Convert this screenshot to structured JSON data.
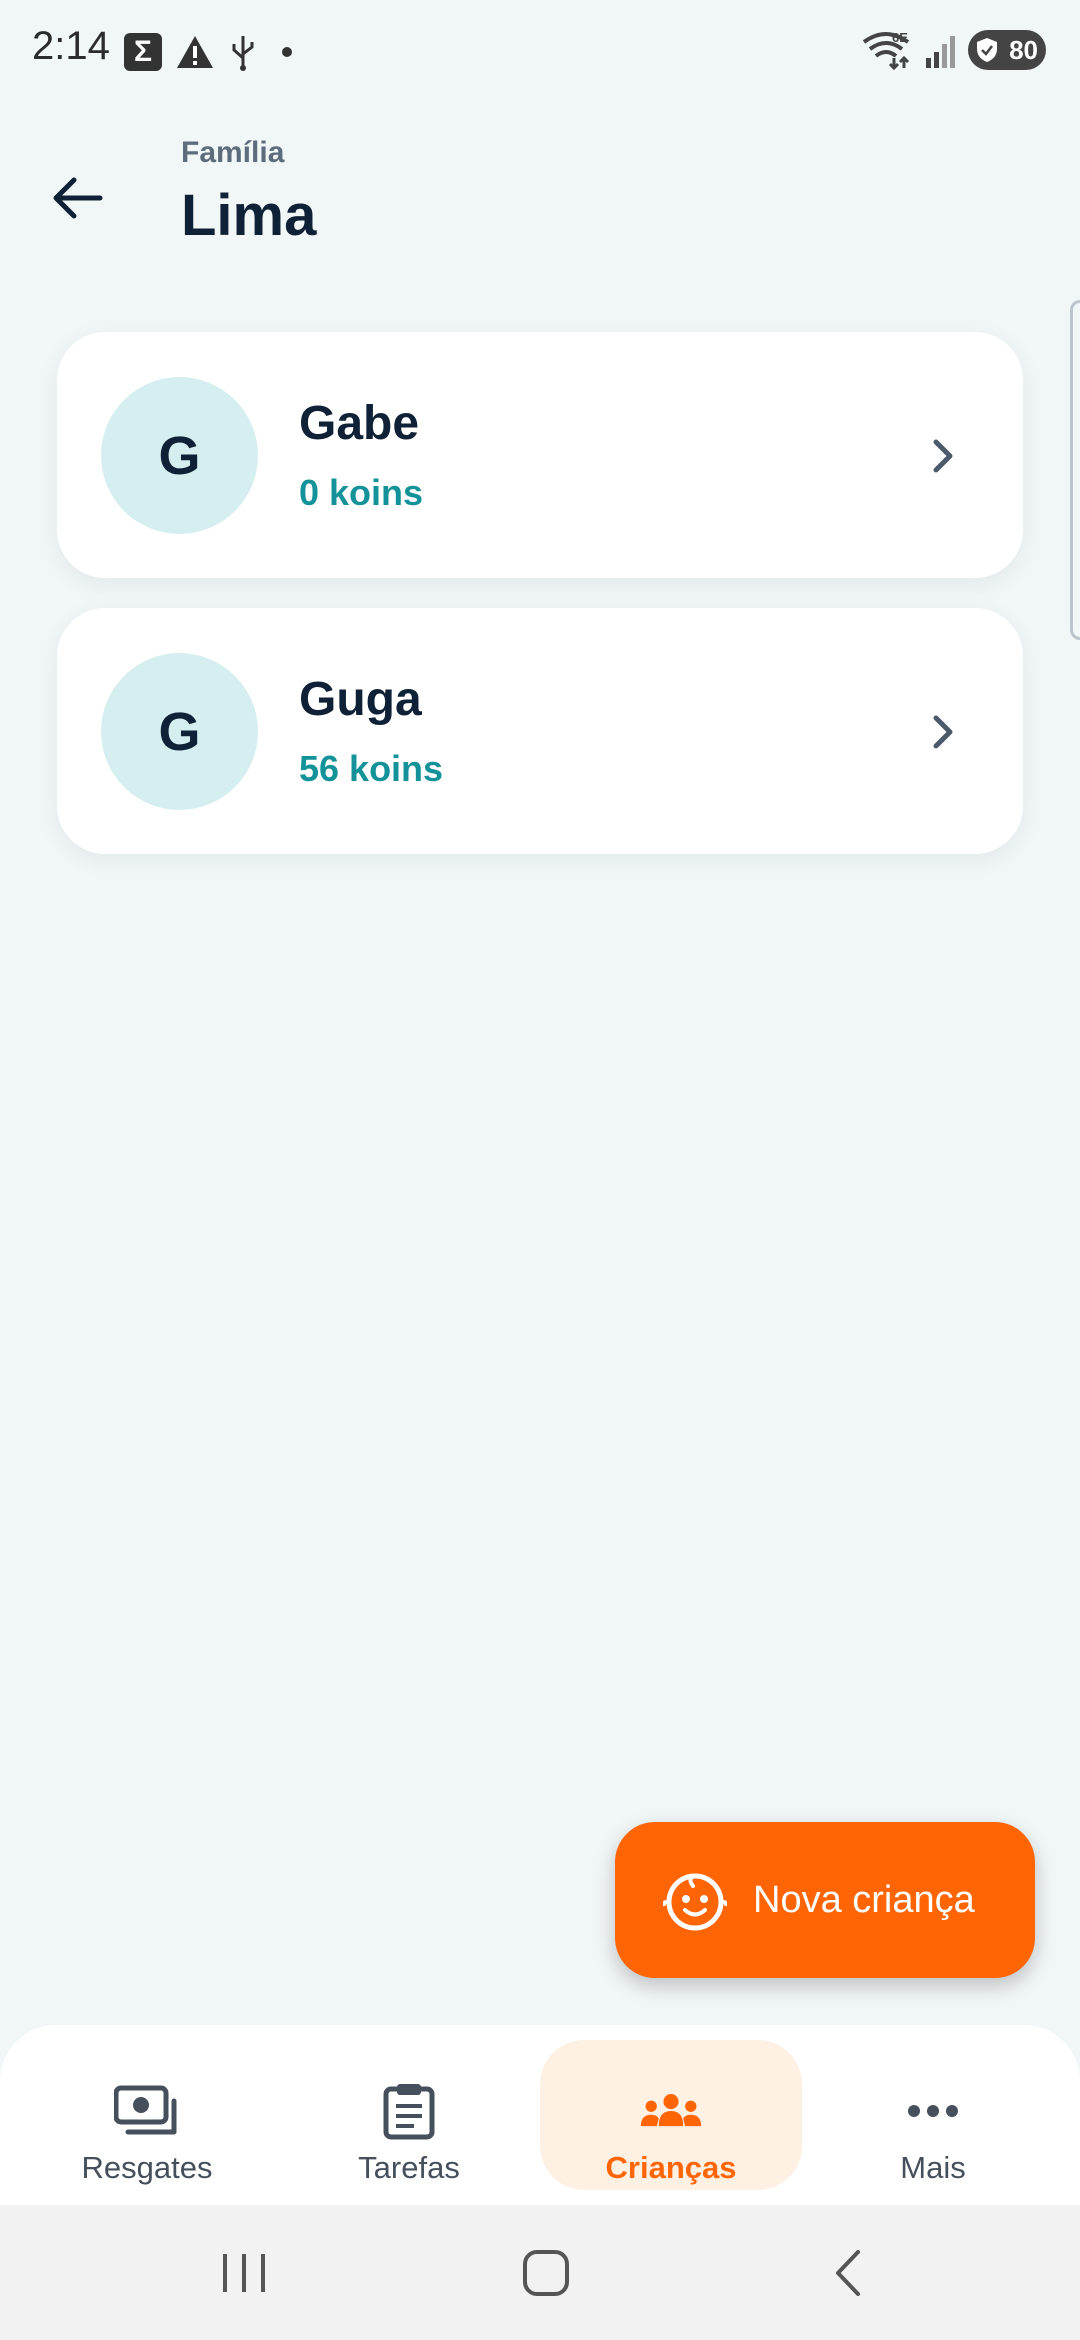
{
  "status_bar": {
    "time": "2:14",
    "network_label": "6E",
    "battery_level": "80"
  },
  "header": {
    "subtitle": "Família",
    "title": "Lima"
  },
  "children": [
    {
      "initial": "G",
      "name": "Gabe",
      "koins": "0 koins"
    },
    {
      "initial": "G",
      "name": "Guga",
      "koins": "56 koins"
    }
  ],
  "fab": {
    "label": "Nova criança"
  },
  "bottom_nav": {
    "items": [
      {
        "label": "Resgates",
        "icon": "money-icon"
      },
      {
        "label": "Tarefas",
        "icon": "clipboard-icon"
      },
      {
        "label": "Crianças",
        "icon": "group-icon",
        "active": true
      },
      {
        "label": "Mais",
        "icon": "more-icon"
      }
    ]
  },
  "colors": {
    "accent": "#ff6505",
    "koins": "#13929a",
    "avatar_bg": "#d5eef0",
    "background": "#f1f6f7",
    "text_dark": "#0f2136"
  }
}
